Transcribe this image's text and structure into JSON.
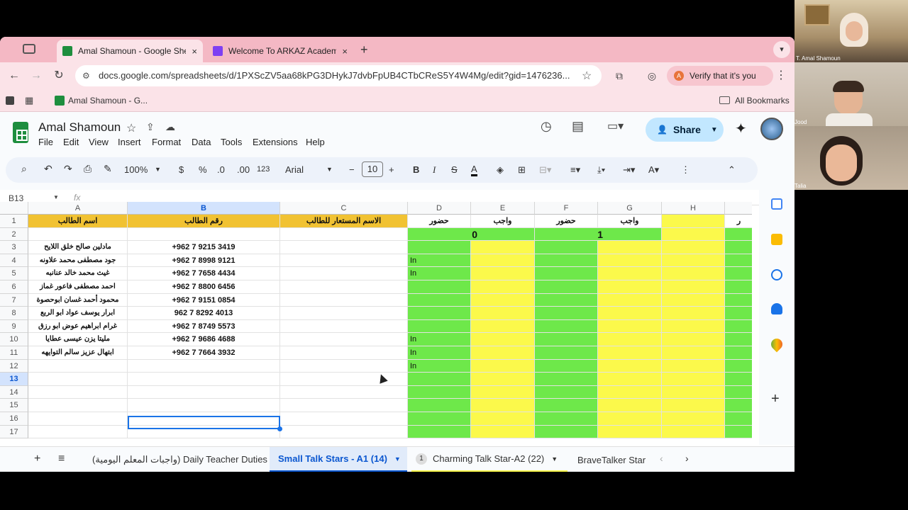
{
  "browser": {
    "tabs": [
      {
        "label": "Amal Shamoun - Google Sheets",
        "close": "×",
        "color": "#1e8e3e"
      },
      {
        "label": "Welcome To ARKAZ Academy",
        "close": "×",
        "color": "#7e3ff2"
      }
    ],
    "new_tab": "+",
    "url": "docs.google.com/spreadsheets/d/1PXScZV5aa68kPG3DHykJ7dvbFpUB4CTbCReS5Y4W4Mg/edit?gid=1476236...",
    "verify_label": "Verify that it's you",
    "verify_badge": "A",
    "bookmark": "Amal Shamoun - G...",
    "all_bookmarks": "All Bookmarks"
  },
  "sheet": {
    "title": "Amal Shamoun",
    "menu": [
      "File",
      "Edit",
      "View",
      "Insert",
      "Format",
      "Data",
      "Tools",
      "Extensions",
      "Help"
    ],
    "share_label": "Share",
    "toolbar": {
      "zoom": "100%",
      "currency": "$",
      "percent": "%",
      "dec_down": ".0",
      "dec_up": ".00",
      "number_format": "123",
      "font": "Arial",
      "font_size": "10",
      "minus": "−",
      "plus": "+"
    },
    "name_box": "B13",
    "fx": "fx"
  },
  "grid": {
    "columns": [
      "A",
      "B",
      "C",
      "D",
      "E",
      "F",
      "G",
      "H",
      ""
    ],
    "rows": [
      "1",
      "2",
      "3",
      "4",
      "5",
      "6",
      "7",
      "8",
      "9",
      "10",
      "11",
      "12",
      "13",
      "14",
      "15",
      "16",
      "17"
    ],
    "header_row": [
      "اسم الطالب",
      "رقم الطالب",
      "الاسم المستعار للطالب",
      "حضور",
      "واجب",
      "حضور",
      "واجب",
      "",
      "ر"
    ],
    "session_numbers": [
      "0",
      "1"
    ],
    "students": [
      {
        "name": "مادلين صالح خلق اللايح",
        "phone": "+962 7 9215 3419"
      },
      {
        "name": "جود مصطفى محمد علاونه",
        "phone": "+962 7 8998 9121"
      },
      {
        "name": "غيث محمد خالد عنانبه",
        "phone": "+962 7 7658 4434"
      },
      {
        "name": "احمد مصطفى فاعور غماز",
        "phone": "+962 7 8800 6456"
      },
      {
        "name": "محمود أحمد غسان ابوحصوة",
        "phone": "+962 7 9151 0854"
      },
      {
        "name": "ابرار يوسف عواد ابو الربع",
        "phone": "962 7 8292 4013"
      },
      {
        "name": "غرام ابراهيم عوض ابو رزق",
        "phone": "+962 7 8749 5573"
      },
      {
        "name": "مليتا يزن عيسى عطايا",
        "phone": "+962 7 9686 4688"
      },
      {
        "name": "ابتهال عزيز سالم التوايهه",
        "phone": "+962 7 7664 3932"
      }
    ],
    "attendance_marks": {
      "4": "In",
      "5": "In",
      "10": "In",
      "11": "In",
      "12": "In"
    }
  },
  "sheet_tabs": [
    {
      "label": "(واجبات المعلم اليومية) Daily Teacher Duties",
      "badge": ""
    },
    {
      "label": "Small Talk Stars - A1 (14)",
      "badge": ""
    },
    {
      "label": "Charming Talk Star-A2 (22)",
      "badge": "1"
    },
    {
      "label": "BraveTalker Star",
      "badge": ""
    }
  ],
  "participants": [
    {
      "name": "T. Amal Shamoun"
    },
    {
      "name": "Jood"
    },
    {
      "name": "Talia"
    }
  ],
  "colors": {
    "green": "#6ee84a",
    "yellow": "#fbf94b",
    "header_orange": "#f1c232",
    "tab_pink": "#f4b8c4",
    "accent": "#0b57d0"
  }
}
